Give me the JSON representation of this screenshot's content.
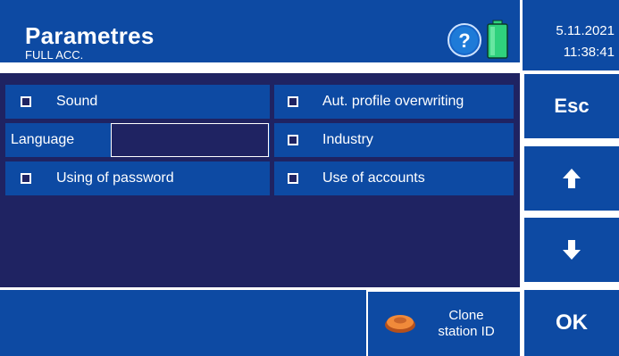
{
  "header": {
    "title": "Parametres",
    "subtitle": "FULL ACC.",
    "help_icon": "question-circle-icon",
    "battery_icon": "battery-full-icon",
    "colors": {
      "panel": "#0d4aa3",
      "background": "#1f2362",
      "battery": "#2fd17d"
    }
  },
  "datetime": {
    "date": "5.11.2021",
    "time": "11:38:41"
  },
  "options": {
    "sound": {
      "label": "Sound",
      "checked": false
    },
    "aut_profile": {
      "label": "Aut. profile overwriting",
      "checked": false
    },
    "language": {
      "label": "Language",
      "value": ""
    },
    "industry": {
      "label": "Industry",
      "checked": false
    },
    "using_password": {
      "label": "Using of password",
      "checked": false
    },
    "use_accounts": {
      "label": "Use of accounts",
      "checked": false
    }
  },
  "sidebar": {
    "esc_label": "Esc",
    "up_icon": "arrow-up-icon",
    "down_icon": "arrow-down-icon",
    "ok_label": "OK"
  },
  "bottom": {
    "clone_label_line1": "Clone",
    "clone_label_line2": "station ID",
    "clone_icon": "key-fob-icon"
  }
}
